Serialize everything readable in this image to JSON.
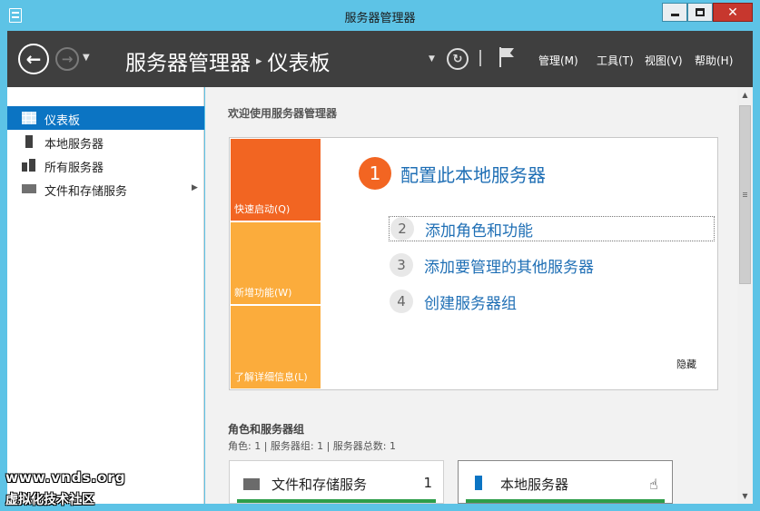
{
  "window": {
    "title": "服务器管理器"
  },
  "header": {
    "breadcrumb_root": "服务器管理器",
    "breadcrumb_sep": "▸",
    "breadcrumb_current": "仪表板",
    "menus": {
      "manage": "管理(M)",
      "tools": "工具(T)",
      "view": "视图(V)",
      "help": "帮助(H)"
    }
  },
  "sidebar": {
    "items": [
      {
        "label": "仪表板",
        "icon": "dashboard-icon",
        "active": true
      },
      {
        "label": "本地服务器",
        "icon": "server-icon",
        "active": false
      },
      {
        "label": "所有服务器",
        "icon": "servers-icon",
        "active": false
      },
      {
        "label": "文件和存储服务",
        "icon": "storage-icon",
        "active": false,
        "expandable": true
      }
    ]
  },
  "main": {
    "welcome_title": "欢迎使用服务器管理器",
    "tiles": [
      "快速启动(Q)",
      "新增功能(W)",
      "了解详细信息(L)"
    ],
    "steps": [
      {
        "num": "1",
        "label": "配置此本地服务器"
      },
      {
        "num": "2",
        "label": "添加角色和功能"
      },
      {
        "num": "3",
        "label": "添加要管理的其他服务器"
      },
      {
        "num": "4",
        "label": "创建服务器组"
      }
    ],
    "hide_label": "隐藏",
    "roles_title": "角色和服务器组",
    "roles_stats": "角色: 1 | 服务器组: 1 | 服务器总数: 1",
    "cards": [
      {
        "title": "文件和存储服务",
        "count": "1"
      },
      {
        "title": "本地服务器",
        "count": ""
      }
    ]
  },
  "watermark": {
    "line1": "www.vnds.org",
    "line2": "虚拟化技术社区"
  },
  "colors": {
    "titlebar": "#5dc3e6",
    "header": "#3f3f3f",
    "accent_orange": "#f26522",
    "tile_yellow": "#fbac3c",
    "link_blue": "#1f6fb5",
    "active_blue": "#0b74c3",
    "status_green": "#2e9e4a"
  }
}
